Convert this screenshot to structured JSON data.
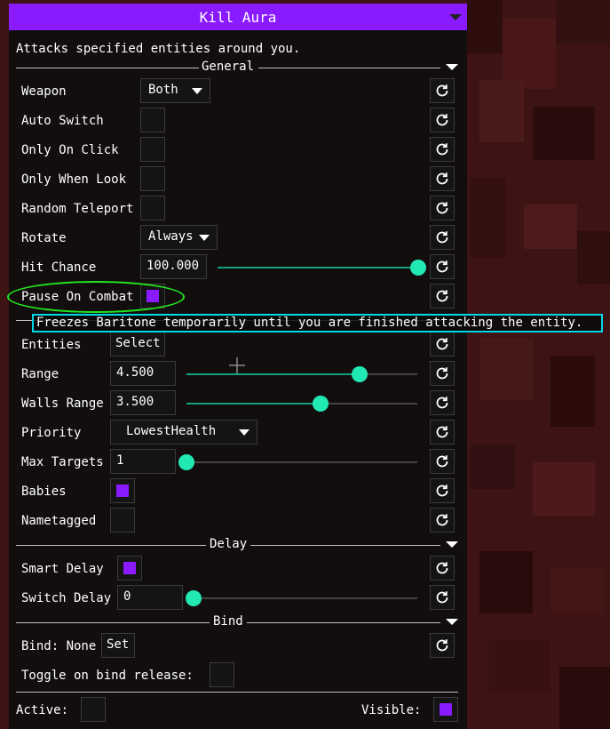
{
  "title": "Kill Aura",
  "description": "Attacks specified entities around you.",
  "colors": {
    "accent": "#8a1aff",
    "slider": "#22e8b4",
    "highlight_oval": "#22e81e",
    "tooltip_border": "#00d8e6"
  },
  "sections": {
    "general": "General",
    "delay": "Delay",
    "bind": "Bind"
  },
  "general": {
    "weapon": {
      "label": "Weapon",
      "value": "Both"
    },
    "auto_switch": {
      "label": "Auto Switch",
      "checked": false
    },
    "only_on_click": {
      "label": "Only On Click",
      "checked": false
    },
    "only_when_look": {
      "label": "Only When Look",
      "checked": false
    },
    "random_teleport": {
      "label": "Random Teleport",
      "checked": false
    },
    "rotate": {
      "label": "Rotate",
      "value": "Always"
    },
    "hit_chance": {
      "label": "Hit Chance",
      "value": "100.000",
      "fraction": 1.0
    },
    "pause_on_combat": {
      "label": "Pause On Combat",
      "checked": true
    }
  },
  "tooltip": "Freezes Baritone temporarily until you are finished attacking the entity.",
  "targeting": {
    "entities": {
      "label": "Entities",
      "button": "Select"
    },
    "range": {
      "label": "Range",
      "value": "4.500",
      "fraction": 0.75
    },
    "walls_range": {
      "label": "Walls Range",
      "value": "3.500",
      "fraction": 0.58
    },
    "priority": {
      "label": "Priority",
      "value": "LowestHealth"
    },
    "max_targets": {
      "label": "Max Targets",
      "value": "1",
      "fraction": 0.0
    },
    "babies": {
      "label": "Babies",
      "checked": true
    },
    "nametagged": {
      "label": "Nametagged",
      "checked": false
    }
  },
  "delay": {
    "smart_delay": {
      "label": "Smart Delay",
      "checked": true
    },
    "switch_delay": {
      "label": "Switch Delay",
      "value": "0",
      "fraction": 0.0
    }
  },
  "bind": {
    "bind_label": "Bind: None",
    "set_button": "Set",
    "toggle_release": {
      "label": "Toggle on bind release:",
      "checked": false
    }
  },
  "footer": {
    "active": {
      "label": "Active:",
      "checked": false
    },
    "visible": {
      "label": "Visible:",
      "checked": true
    }
  }
}
